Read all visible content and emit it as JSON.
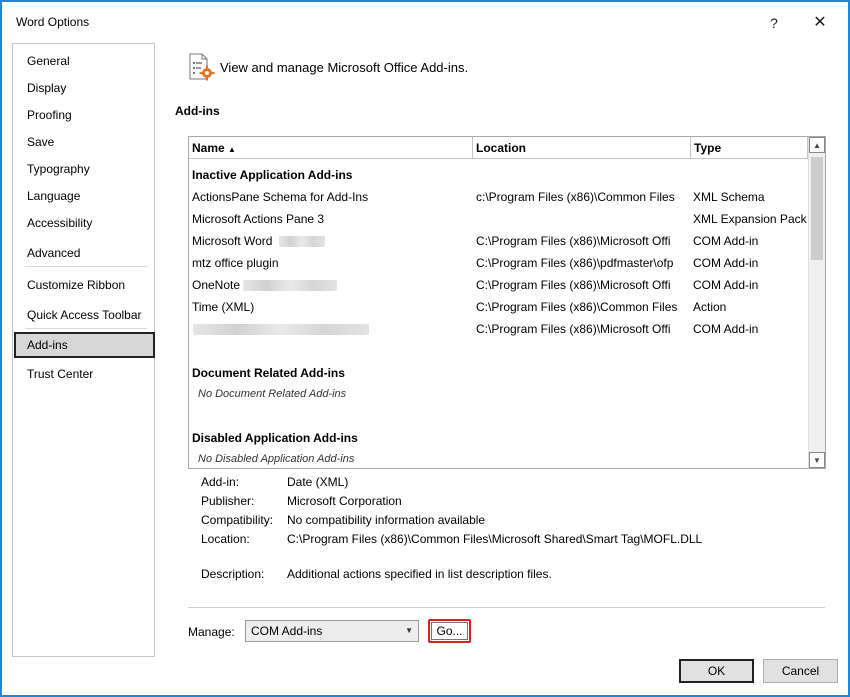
{
  "window": {
    "title": "Word Options",
    "help_glyph": "?",
    "close_glyph": "✕"
  },
  "nav": {
    "items": [
      {
        "label": "General"
      },
      {
        "label": "Display"
      },
      {
        "label": "Proofing"
      },
      {
        "label": "Save"
      },
      {
        "label": "Typography"
      },
      {
        "label": "Language"
      },
      {
        "label": "Accessibility"
      },
      {
        "label": "Advanced"
      },
      {
        "label": "Customize Ribbon"
      },
      {
        "label": "Quick Access Toolbar"
      },
      {
        "label": "Add-ins"
      },
      {
        "label": "Trust Center"
      }
    ],
    "active": "Add-ins"
  },
  "header": {
    "text": "View and manage Microsoft Office Add-ins."
  },
  "section": {
    "title": "Add-ins"
  },
  "table": {
    "columns": {
      "name": "Name",
      "sort_glyph": "▲",
      "location": "Location",
      "type": "Type"
    },
    "groups": {
      "inactive": "Inactive Application Add-ins",
      "document": "Document Related Add-ins",
      "document_empty": "No Document Related Add-ins",
      "disabled": "Disabled Application Add-ins",
      "disabled_empty": "No Disabled Application Add-ins"
    },
    "rows": [
      {
        "name": "ActionsPane Schema for Add-Ins",
        "location": "c:\\Program Files (x86)\\Common Files",
        "type": "XML Schema"
      },
      {
        "name": "Microsoft Actions Pane 3",
        "location": "",
        "type": "XML Expansion Pack"
      },
      {
        "name": "Microsoft Word",
        "location": "C:\\Program Files (x86)\\Microsoft Offi",
        "type": "COM Add-in"
      },
      {
        "name": "mtz office plugin",
        "location": "C:\\Program Files (x86)\\pdfmaster\\ofp",
        "type": "COM Add-in"
      },
      {
        "name": "OneNote",
        "location": "C:\\Program Files (x86)\\Microsoft Offi",
        "type": "COM Add-in"
      },
      {
        "name": "Time (XML)",
        "location": "C:\\Program Files (x86)\\Common Files",
        "type": "Action"
      },
      {
        "name": "",
        "location": "C:\\Program Files (x86)\\Microsoft Offi",
        "type": "COM Add-in"
      }
    ]
  },
  "details": {
    "addin_label": "Add-in:",
    "addin_value": "Date (XML)",
    "publisher_label": "Publisher:",
    "publisher_value": "Microsoft Corporation",
    "compat_label": "Compatibility:",
    "compat_value": "No compatibility information available",
    "location_label": "Location:",
    "location_value": "C:\\Program Files (x86)\\Common Files\\Microsoft Shared\\Smart Tag\\MOFL.DLL",
    "desc_label": "Description:",
    "desc_value": "Additional actions specified in list description files."
  },
  "manage": {
    "label": "Manage:",
    "selected": "COM Add-ins",
    "go_label": "Go..."
  },
  "footer": {
    "ok_label": "OK",
    "cancel_label": "Cancel"
  },
  "colors": {
    "accent_border": "#1e88d8",
    "highlight_red": "#e02020",
    "icon_orange": "#e8731f"
  }
}
